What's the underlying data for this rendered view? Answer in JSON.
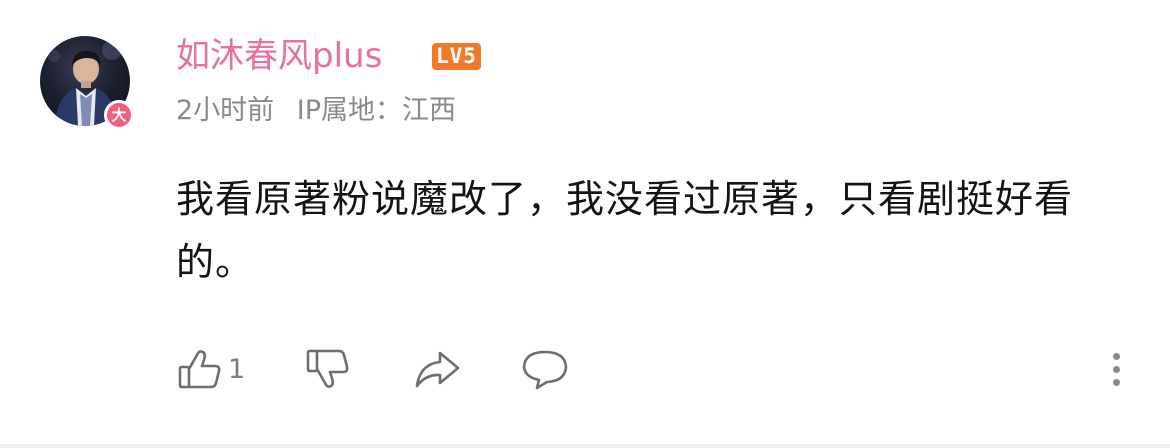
{
  "user": {
    "name": "如沐春风plus",
    "level_badge": "LV5",
    "avatar_badge": "大"
  },
  "meta": {
    "time": "2小时前",
    "ip_location": "IP属地：江西"
  },
  "comment": {
    "text": "我看原著粉说魔改了，我没看过原著，只看剧挺好看的。"
  },
  "actions": {
    "like_count": "1",
    "icons": [
      "thumbs-up-icon",
      "thumbs-down-icon",
      "share-icon",
      "comment-icon",
      "more-icon"
    ]
  },
  "colors": {
    "username": "#e86fa0",
    "level_badge": "#f07a2a",
    "avatar_badge": "#f4607a",
    "meta_text": "#8a8a8a",
    "body_text": "#141414",
    "icon": "#6e6e6e"
  }
}
